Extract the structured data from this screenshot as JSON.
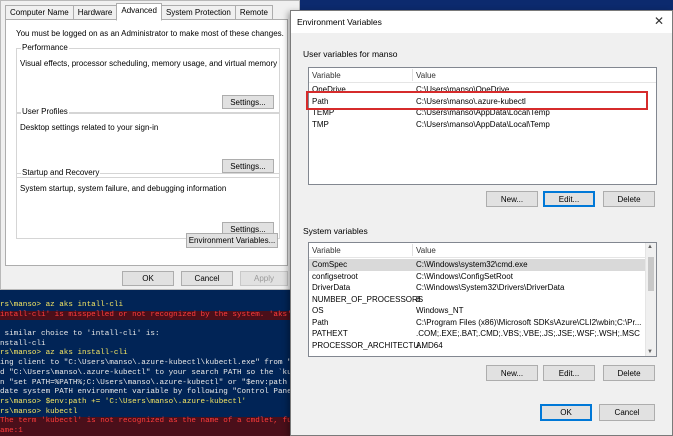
{
  "system_properties": {
    "tabs": [
      "Computer Name",
      "Hardware",
      "Advanced",
      "System Protection",
      "Remote"
    ],
    "active_tab": "Advanced",
    "admin_note": "You must be logged on as an Administrator to make most of these changes.",
    "groups": {
      "performance": {
        "title": "Performance",
        "desc": "Visual effects, processor scheduling, memory usage, and virtual memory",
        "button": "Settings..."
      },
      "user_profiles": {
        "title": "User Profiles",
        "desc": "Desktop settings related to your sign-in",
        "button": "Settings..."
      },
      "startup_recovery": {
        "title": "Startup and Recovery",
        "desc": "System startup, system failure, and debugging information",
        "button": "Settings..."
      }
    },
    "env_button": "Environment Variables...",
    "ok": "OK",
    "cancel": "Cancel",
    "apply": "Apply"
  },
  "env_dialog": {
    "title": "Environment Variables",
    "user_section": "User variables for manso",
    "col_variable": "Variable",
    "col_value": "Value",
    "user_vars": [
      {
        "name": "OneDrive",
        "value": "C:\\Users\\manso\\OneDrive"
      },
      {
        "name": "Path",
        "value": "C:\\Users\\manso\\.azure-kubectl"
      },
      {
        "name": "TEMP",
        "value": "C:\\Users\\manso\\AppData\\Local\\Temp"
      },
      {
        "name": "TMP",
        "value": "C:\\Users\\manso\\AppData\\Local\\Temp"
      }
    ],
    "user_buttons": {
      "new": "New...",
      "edit": "Edit...",
      "delete": "Delete"
    },
    "system_section": "System variables",
    "system_vars": [
      {
        "name": "ComSpec",
        "value": "C:\\Windows\\system32\\cmd.exe"
      },
      {
        "name": "configsetroot",
        "value": "C:\\Windows\\ConfigSetRoot"
      },
      {
        "name": "DriverData",
        "value": "C:\\Windows\\System32\\Drivers\\DriverData"
      },
      {
        "name": "NUMBER_OF_PROCESSORS",
        "value": "8"
      },
      {
        "name": "OS",
        "value": "Windows_NT"
      },
      {
        "name": "Path",
        "value": "C:\\Program Files (x86)\\Microsoft SDKs\\Azure\\CLI2\\wbin;C:\\Pr..."
      },
      {
        "name": "PATHEXT",
        "value": ".COM;.EXE;.BAT;.CMD;.VBS;.VBE;.JS;.JSE;.WSF;.WSH;.MSC"
      },
      {
        "name": "PROCESSOR_ARCHITECTU...",
        "value": "AMD64"
      }
    ],
    "system_buttons": {
      "new": "New...",
      "edit": "Edit...",
      "delete": "Delete"
    },
    "ok": "OK",
    "cancel": "Cancel"
  },
  "terminal": {
    "lines": [
      {
        "text": "rs\\manso> az aks intall-cli",
        "style": "cmd"
      },
      {
        "text": "intall-cli' is misspelled or not recognized by the system. 'aks' command group. See 'az aks --help'.",
        "style": "err"
      },
      {
        "text": "",
        "style": ""
      },
      {
        "text": " similar choice to 'intall-cli' is:",
        "style": ""
      },
      {
        "text": "nstall-cli",
        "style": ""
      },
      {
        "text": "rs\\manso> az aks install-cli",
        "style": "cmd"
      },
      {
        "text": "ing client to \"C:\\Users\\manso\\.azure-kubectl\\kubectl.exe\" from \"http",
        "style": ""
      },
      {
        "text": "d \"C:\\Users\\manso\\.azure-kubectl\" to your search PATH so the `kubect",
        "style": ""
      },
      {
        "text": "n \"set PATH=%PATH%;C:\\Users\\manso\\.azure-kubectl\" or \"$env:path += '",
        "style": ""
      },
      {
        "text": "date system PATH environment variable by following \"Control Panel->",
        "style": ""
      },
      {
        "text": "rs\\manso> $env:path += 'C:\\Users\\manso\\.azure-kubectl'",
        "style": "cmd"
      },
      {
        "text": "rs\\manso> kubectl",
        "style": "cmd"
      },
      {
        "text": "The term 'kubectl' is not recognized as the name of a cmdlet, func",
        "style": "err"
      },
      {
        "text": "ame:1",
        "style": "err"
      }
    ]
  },
  "colors": {
    "highlight": "#d62b2b",
    "terminal_bg": "#012456",
    "focus_blue": "#0078d7"
  }
}
